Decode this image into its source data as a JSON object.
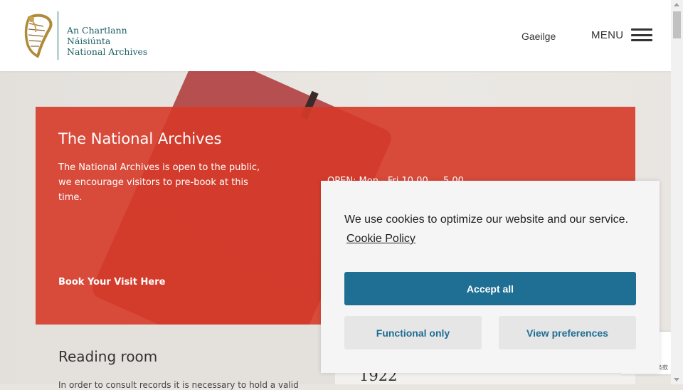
{
  "header": {
    "logo_irish": "An Chartlann Náisiúnta",
    "logo_english": "National Archives",
    "language_link": "Gaeilge",
    "menu_label": "MENU"
  },
  "hero": {
    "title": "The National Archives",
    "description": "The National Archives is open to the public, we encourage visitors to pre-book at this time.",
    "opening_hours": "OPEN: Mon - Fri 10.00 — 5.00",
    "cta_link": "Book Your Visit Here"
  },
  "reading_room": {
    "title": "Reading room",
    "text": "In order to consult records it is necessary to hold a valid"
  },
  "feature": {
    "year": "1922"
  },
  "cookie_banner": {
    "message": "We use cookies to optimize our website and our service.",
    "policy_link": "Cookie Policy",
    "accept_all": "Accept all",
    "functional_only": "Functional only",
    "view_preferences": "View preferences"
  },
  "corner_widget": {
    "label": "条款"
  },
  "colors": {
    "hero_red": "#d63a28",
    "accent_blue": "#1f6e94",
    "logo_teal": "#1c5f63",
    "harp_gold": "#b08a3c"
  }
}
